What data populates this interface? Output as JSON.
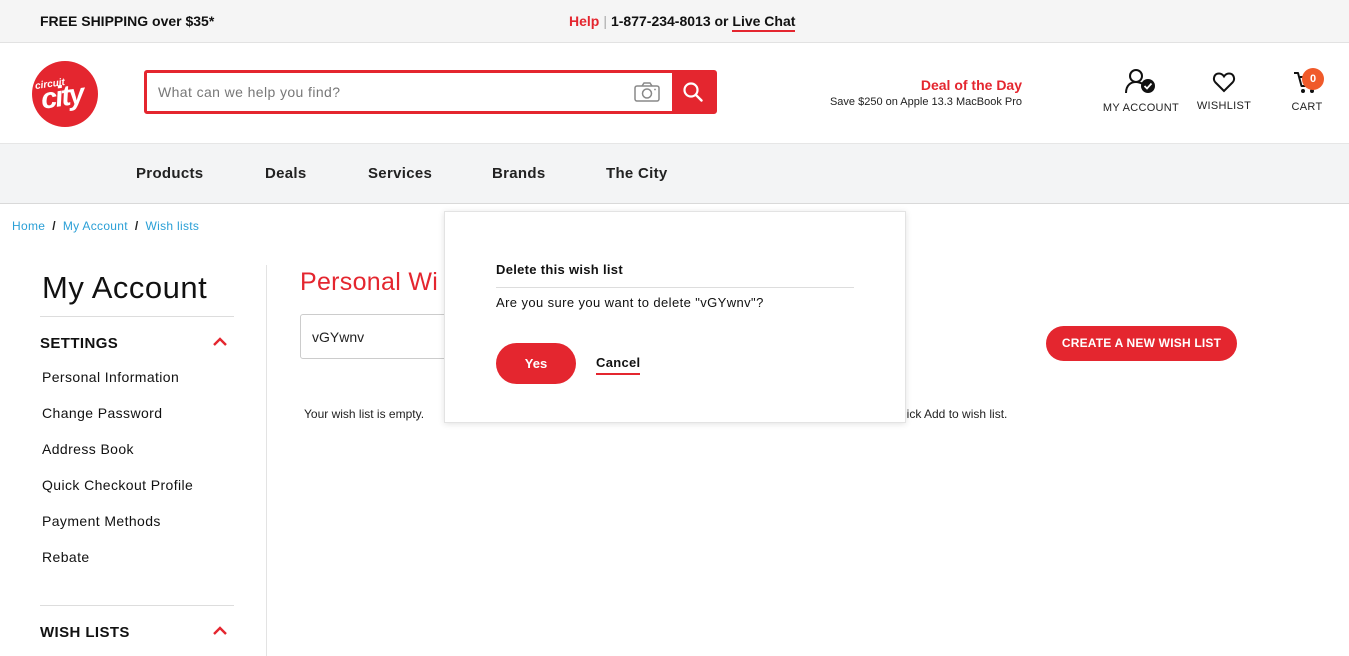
{
  "topbar": {
    "shipping": "FREE SHIPPING over $35*",
    "help": "Help",
    "separator": "|",
    "phone": "1-877-234-8013 or",
    "live_chat": "Live Chat"
  },
  "header": {
    "logo_small": "circuit",
    "logo_big": "city",
    "search_placeholder": "What can we help you find?",
    "deal_title": "Deal of the Day",
    "deal_subtitle": "Save $250 on Apple 13.3 MacBook Pro",
    "account_label": "MY ACCOUNT",
    "wishlist_label": "WISHLIST",
    "cart_label": "CART",
    "cart_count": "0"
  },
  "nav": {
    "items": [
      "Products",
      "Deals",
      "Services",
      "Brands",
      "The City"
    ]
  },
  "breadcrumb": {
    "items": [
      "Home",
      "My Account",
      "Wish lists"
    ],
    "separator": "/"
  },
  "sidebar": {
    "title": "My Account",
    "settings_heading": "SETTINGS",
    "settings_links": [
      "Personal Information",
      "Change Password",
      "Address Book",
      "Quick Checkout Profile",
      "Payment Methods",
      "Rebate"
    ],
    "wishlists_heading": "WISH LISTS"
  },
  "main": {
    "title": "Personal Wi",
    "selected_wishlist": "vGYwnv",
    "create_button": "CREATE A NEW WISH LIST",
    "empty_text_left": "Your wish list is empty.",
    "empty_text_right": "lick Add to wish list."
  },
  "dialog": {
    "title": "Delete this wish list",
    "message": "Are you sure you want to delete \"vGYwnv\"?",
    "yes": "Yes",
    "cancel": "Cancel"
  },
  "colors": {
    "brand_red": "#e4262f",
    "link_blue": "#2a9fd6",
    "cart_badge": "#f05a2a"
  }
}
